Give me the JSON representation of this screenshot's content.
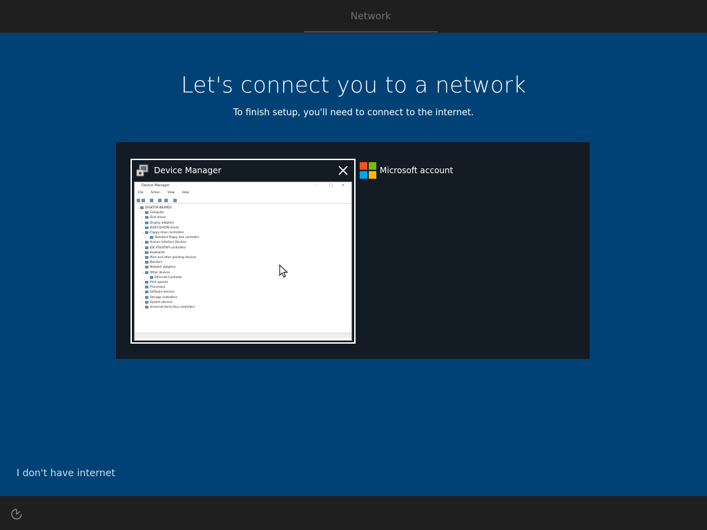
{
  "header": {
    "tab_label": "Network"
  },
  "main": {
    "title": "Let's connect you to a network",
    "subtitle": "To finish setup, you'll need to connect to the internet."
  },
  "switcher": {
    "windows": [
      {
        "title": "Device Manager",
        "icon": "device-manager-icon",
        "thumbnail": {
          "window_title": "Device Manager",
          "menu": [
            "File",
            "Action",
            "View",
            "Help"
          ],
          "tree": [
            {
              "label": "DESKTOP-8N3MD3",
              "level": 0,
              "expanded": true
            },
            {
              "label": "Computer",
              "level": 1
            },
            {
              "label": "Disk drives",
              "level": 1
            },
            {
              "label": "Display adapters",
              "level": 1
            },
            {
              "label": "DVD/CD-ROM drives",
              "level": 1
            },
            {
              "label": "Floppy drive controllers",
              "level": 1,
              "expanded": true
            },
            {
              "label": "Standard floppy disk controller",
              "level": 2
            },
            {
              "label": "Human Interface Devices",
              "level": 1
            },
            {
              "label": "IDE ATA/ATAPI controllers",
              "level": 1
            },
            {
              "label": "Keyboards",
              "level": 1
            },
            {
              "label": "Mice and other pointing devices",
              "level": 1
            },
            {
              "label": "Monitors",
              "level": 1
            },
            {
              "label": "Network adapters",
              "level": 1
            },
            {
              "label": "Other devices",
              "level": 1,
              "expanded": true
            },
            {
              "label": "Ethernet Controller",
              "level": 2
            },
            {
              "label": "Print queues",
              "level": 1
            },
            {
              "label": "Processors",
              "level": 1
            },
            {
              "label": "Software devices",
              "level": 1
            },
            {
              "label": "Storage controllers",
              "level": 1
            },
            {
              "label": "System devices",
              "level": 1
            },
            {
              "label": "Universal Serial Bus controllers",
              "level": 1
            }
          ]
        }
      },
      {
        "title": "Microsoft account",
        "icon": "microsoft-logo-icon"
      }
    ]
  },
  "footer": {
    "no_internet_label": "I don't have internet",
    "accessibility_icon": "ease-of-access-icon"
  },
  "colors": {
    "background": "#004276",
    "bar": "#1f1f1f",
    "switcher_bg": "#131c24",
    "link": "#c6dcf0",
    "ms_red": "#f25022",
    "ms_green": "#7fba00",
    "ms_blue": "#00a4ef",
    "ms_yellow": "#ffb900"
  }
}
